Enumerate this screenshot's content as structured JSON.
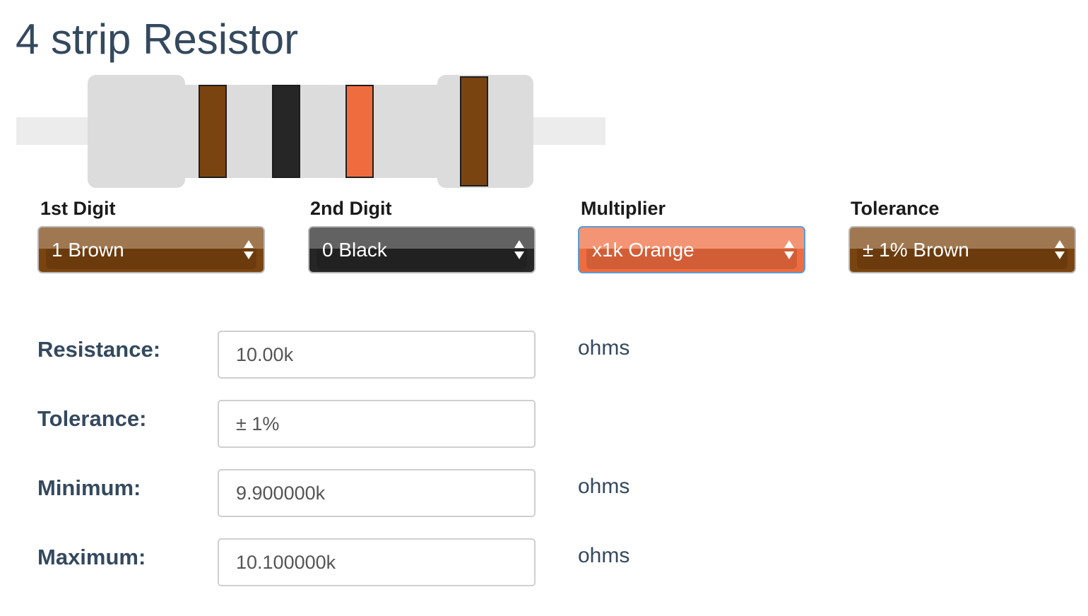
{
  "title": "4 strip Resistor",
  "colors": {
    "brown": "#7a4410",
    "black": "#262626",
    "orange": "#ef6c3f",
    "body": "#dcdcdc",
    "lead": "#ececec",
    "text": "#34495e"
  },
  "bands": [
    {
      "name": "1st Digit",
      "color": "#7a4410"
    },
    {
      "name": "2nd Digit",
      "color": "#262626"
    },
    {
      "name": "Multiplier",
      "color": "#ef6c3f"
    },
    {
      "name": "Tolerance",
      "color": "#7a4410"
    }
  ],
  "selectors": [
    {
      "label": "1st Digit",
      "value": "1 Brown",
      "color": "#7a4410"
    },
    {
      "label": "2nd Digit",
      "value": "0 Black",
      "color": "#262626"
    },
    {
      "label": "Multiplier",
      "value": "x1k Orange",
      "color": "#ef6c3f"
    },
    {
      "label": "Tolerance",
      "value": "± 1% Brown",
      "color": "#7a4410"
    }
  ],
  "results": {
    "resistance": {
      "label": "Resistance:",
      "value": "10.00k",
      "unit": "ohms"
    },
    "tolerance": {
      "label": "Tolerance:",
      "value": "± 1%"
    },
    "minimum": {
      "label": "Minimum:",
      "value": "9.900000k",
      "unit": "ohms"
    },
    "maximum": {
      "label": "Maximum:",
      "value": "10.100000k",
      "unit": "ohms"
    }
  }
}
